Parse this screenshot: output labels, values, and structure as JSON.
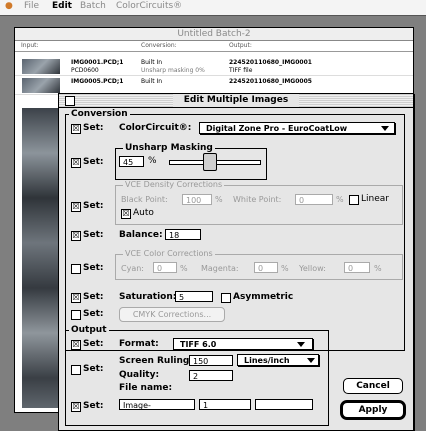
{
  "menubar": {
    "apple_icon": "apple-logo-icon",
    "file": "File",
    "edit": "Edit",
    "batch": "Batch",
    "colorcircuits": "ColorCircuits®"
  },
  "batch_window": {
    "title": "Untitled Batch-2",
    "columns": {
      "input": "Input:",
      "conversion": "Conversion:",
      "output": "Output:"
    },
    "rows": [
      {
        "name": "IMG0001.PCD;1",
        "sub": "PCD0600",
        "conv1": "Built In",
        "conv2": "Unsharp masking 0%",
        "out1": "224520110680_IMG0001",
        "out2": "TIFF file"
      },
      {
        "name": "IMG0005.PCD;1",
        "sub": "",
        "conv1": "Built In",
        "conv2": "",
        "out1": "224520110680_IMG0005",
        "out2": ""
      }
    ]
  },
  "dialog": {
    "title": "Edit Multiple Images",
    "conversion_group": "Conversion",
    "set_label": "Set:",
    "colorcircuit_label": "ColorCircuit®:",
    "colorcircuit_value": "Digital Zone Pro - EuroCoatLow",
    "unsharp_group": "Unsharp Masking",
    "unsharp_value": "45",
    "percent": "%",
    "vce_density_group": "VCE Density Corrections",
    "black_point_label": "Black Point:",
    "black_point_value": "100",
    "white_point_label": "White Point:",
    "white_point_value": "0",
    "linear_label": "Linear",
    "auto_label": "Auto",
    "balance_label": "Balance:",
    "balance_value": "18",
    "vce_color_group": "VCE Color Corrections",
    "cyan_label": "Cyan:",
    "cyan_value": "0",
    "magenta_label": "Magenta:",
    "magenta_value": "0",
    "yellow_label": "Yellow:",
    "yellow_value": "0",
    "saturation_label": "Saturation:",
    "saturation_value": "5",
    "asymmetric_label": "Asymmetric",
    "cmyk_button": "CMYK Corrections...",
    "output_group": "Output",
    "format_label": "Format:",
    "format_value": "TIFF 6.0",
    "screen_ruling_label": "Screen Ruling:",
    "screen_ruling_value": "150",
    "screen_ruling_unit": "Lines/inch",
    "quality_label": "Quality:",
    "quality_value": "2",
    "file_name_label": "File name:",
    "file_name_value": "Image-",
    "file_number_value": "1",
    "file_suffix_value": "",
    "cancel_button": "Cancel",
    "apply_button": "Apply",
    "check_mark": "☒"
  }
}
